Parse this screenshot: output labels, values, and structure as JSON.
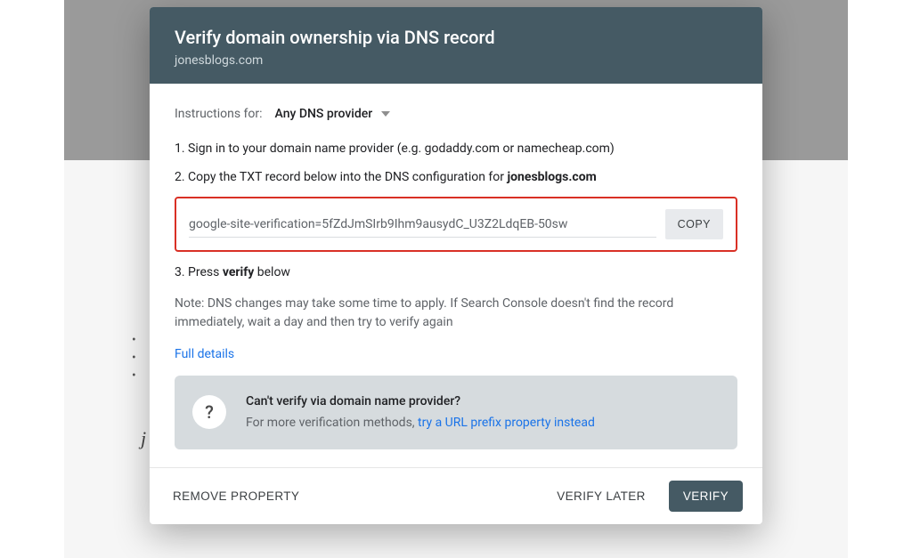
{
  "modal": {
    "title": "Verify domain ownership via DNS record",
    "domain": "jonesblogs.com",
    "instructions_label": "Instructions for:",
    "provider_selected": "Any DNS provider",
    "step1": "1. Sign in to your domain name provider (e.g. godaddy.com or namecheap.com)",
    "step2_prefix": "2. Copy the TXT record below into the DNS configuration for ",
    "step2_domain": "jonesblogs.com",
    "txt_record": "google-site-verification=5fZdJmSIrb9Ihm9ausydC_U3Z2LdqEB-50sw",
    "copy_label": "COPY",
    "step3_prefix": "3. Press ",
    "step3_strong": "verify",
    "step3_suffix": " below",
    "note": "Note: DNS changes may take some time to apply. If Search Console doesn't find the record immediately, wait a day and then try to verify again",
    "full_details": "Full details",
    "alt": {
      "title": "Can't verify via domain name provider?",
      "subtitle_prefix": "For more verification methods, ",
      "subtitle_link": "try a URL prefix property instead"
    },
    "footer": {
      "remove": "REMOVE PROPERTY",
      "later": "VERIFY LATER",
      "verify": "VERIFY"
    }
  }
}
